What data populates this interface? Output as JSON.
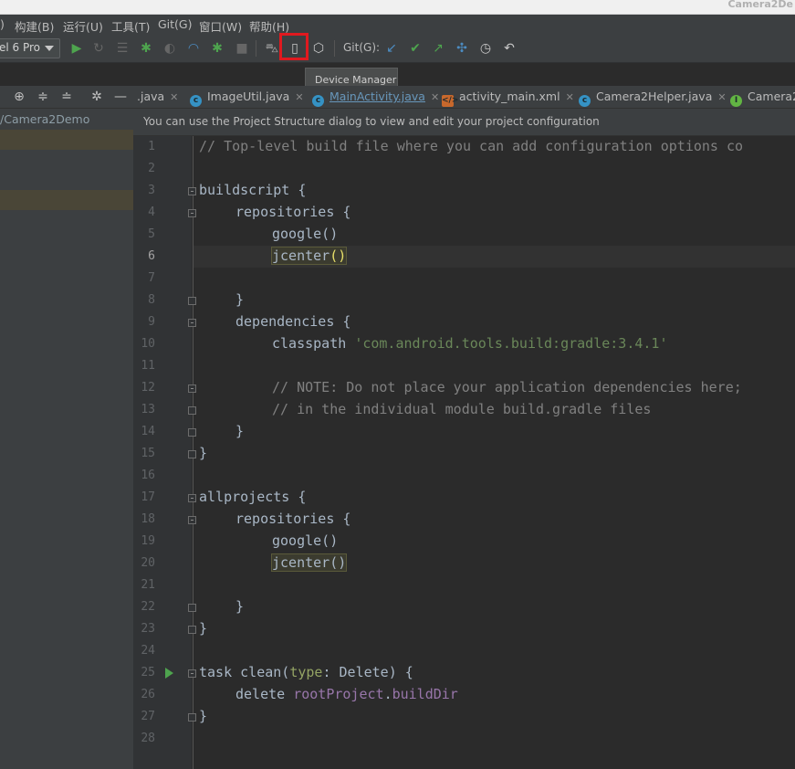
{
  "window": {
    "title": "Camera2De"
  },
  "menu": {
    "items": [
      "构建(B)",
      "运行(U)",
      "工具(T)",
      "Git(G)",
      "窗口(W)",
      "帮助(H)"
    ],
    "partial_left": ")"
  },
  "toolbar": {
    "device_selector": "el 6 Pro",
    "git_label": "Git(G):",
    "colors": {
      "run": "#4ea44e",
      "highlight_box": "#e0191f"
    },
    "icons": [
      "run-icon",
      "rerun-icon",
      "coverage-icon",
      "debug-icon",
      "profile-icon",
      "attach-icon",
      "apply-changes-icon",
      "stop-icon",
      "sync-icon",
      "device-manager-icon",
      "sdk-manager-icon",
      "git-update-icon",
      "git-commit-icon",
      "git-push-icon",
      "git-compare-icon",
      "git-history-icon",
      "git-rollback-icon"
    ]
  },
  "tooltip": {
    "text": "Device Manager"
  },
  "project_panel": {
    "path": "/Camera2Demo"
  },
  "tabs": [
    {
      "label": ".java",
      "icon": "",
      "active": false
    },
    {
      "label": "ImageUtil.java",
      "icon": "class-icon",
      "active": false
    },
    {
      "label": "MainActivity.java",
      "icon": "class-icon",
      "active": false
    },
    {
      "label": "activity_main.xml",
      "icon": "xml-icon",
      "active": false
    },
    {
      "label": "Camera2Helper.java",
      "icon": "class-icon",
      "active": false
    },
    {
      "label": "Camera2",
      "icon": "interface-icon",
      "active": false
    }
  ],
  "notification": {
    "text": "You can use the Project Structure dialog to view and edit your project configuration"
  },
  "editor": {
    "current_line": 6,
    "lines": [
      {
        "n": "1",
        "text": "// Top-level build file where you can add configuration options co"
      },
      {
        "n": "2",
        "text": ""
      },
      {
        "n": "3",
        "text": "buildscript {"
      },
      {
        "n": "4",
        "text": "    repositories {"
      },
      {
        "n": "5",
        "text": "        google()"
      },
      {
        "n": "6",
        "text": "        jcenter()"
      },
      {
        "n": "7",
        "text": ""
      },
      {
        "n": "8",
        "text": "    }"
      },
      {
        "n": "9",
        "text": "    dependencies {"
      },
      {
        "n": "10",
        "text": "        classpath 'com.android.tools.build:gradle:3.4.1'"
      },
      {
        "n": "11",
        "text": ""
      },
      {
        "n": "12",
        "text": "        // NOTE: Do not place your application dependencies here;"
      },
      {
        "n": "13",
        "text": "        // in the individual module build.gradle files"
      },
      {
        "n": "14",
        "text": "    }"
      },
      {
        "n": "15",
        "text": "}"
      },
      {
        "n": "16",
        "text": ""
      },
      {
        "n": "17",
        "text": "allprojects {"
      },
      {
        "n": "18",
        "text": "    repositories {"
      },
      {
        "n": "19",
        "text": "        google()"
      },
      {
        "n": "20",
        "text": "        jcenter()"
      },
      {
        "n": "21",
        "text": ""
      },
      {
        "n": "22",
        "text": "    }"
      },
      {
        "n": "23",
        "text": "}"
      },
      {
        "n": "24",
        "text": ""
      },
      {
        "n": "25",
        "text": "task clean(type: Delete) {"
      },
      {
        "n": "26",
        "text": "    delete rootProject.buildDir"
      },
      {
        "n": "27",
        "text": "}"
      },
      {
        "n": "28",
        "text": ""
      }
    ],
    "segments": {
      "l1_cmt": "// Top-level build file where you can add configuration options co",
      "l3": "buildscript {",
      "l4": "repositories {",
      "l5": "google()",
      "l6_fn": "jcenter",
      "l6_open": "(",
      "l6_close": ")",
      "l8": "}",
      "l9": "dependencies {",
      "l10_a": "classpath ",
      "l10_str": "'com.android.tools.build:gradle:3.4.1'",
      "l12_cmt": "// NOTE: Do not place your application dependencies here;",
      "l13_cmt": "// in the individual module build.gradle files",
      "l14": "}",
      "l15": "}",
      "l17": "allprojects {",
      "l18": "repositories {",
      "l19": "google()",
      "l20": "jcenter()",
      "l22": "}",
      "l23": "}",
      "l25_a": "task clean(",
      "l25_prm": "type",
      "l25_b": ": Delete) {",
      "l26_a": "delete ",
      "l26_fld1": "rootProject",
      "l26_dot": ".",
      "l26_fld2": "buildDir",
      "l27": "}"
    }
  }
}
